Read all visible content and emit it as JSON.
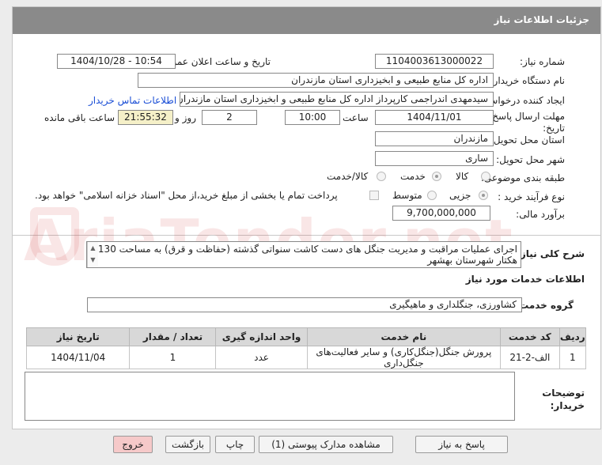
{
  "header": {
    "title": "جزئیات اطلاعات نیاز"
  },
  "form": {
    "need_number_label": "شماره نیاز:",
    "need_number": "1104003613000022",
    "announce_label": "تاریخ و ساعت اعلان عمومی:",
    "announce_value": "1404/10/28 - 10:54",
    "buyer_label": "نام دستگاه خریدار:",
    "buyer_value": "اداره کل منابع طبیعی و ابخیزداری استان مازندران",
    "creator_label": "ایجاد کننده درخواست:",
    "creator_value": "سیدمهدی اندراجمی کارپرداز اداره کل منابع طبیعی و ابخیزداری استان مازندران",
    "contact_link": "اطلاعات تماس خریدار",
    "deadline_label_1": "مهلت ارسال پاسخ: تا",
    "deadline_label_2": "تاریخ:",
    "deadline_date": "1404/11/01",
    "time_label": "ساعت",
    "deadline_time": "10:00",
    "days_value": "2",
    "days_label": "روز و",
    "remaining_time": "21:55:32",
    "remaining_label": "ساعت باقی مانده",
    "province_label": "استان محل تحویل:",
    "province_value": "مازندران",
    "city_label": "شهر محل تحویل:",
    "city_value": "ساری",
    "category_label": "طبقه بندی موضوعی:",
    "category_options": [
      "کالا",
      "خدمت",
      "کالا/خدمت"
    ],
    "category_selected": "خدمت",
    "process_label": "نوع فرآیند خرید :",
    "process_options": [
      "جزیی",
      "متوسط"
    ],
    "process_selected": "جزیی",
    "payment_note": "پرداخت تمام یا بخشی از مبلغ خرید،از محل \"اسناد خزانه اسلامی\" خواهد بود.",
    "estimate_label": "برآورد مالی:",
    "estimate_value": "9,700,000,000"
  },
  "summary": {
    "label": "شرح کلی نیاز:",
    "text": "اجرای عملیات مراقبت و مدیریت جنگل های دست کاشت سنواتی گذشته (حفاظت و قرق) به مساحت 130 هکتار شهرستان بهشهر"
  },
  "services": {
    "section_title": "اطلاعات خدمات مورد نیاز",
    "group_label": "گروه خدمت:",
    "group_value": "کشاورزی، جنگلداری و ماهیگیری",
    "columns": [
      "ردیف",
      "کد خدمت",
      "نام خدمت",
      "واحد اندازه گیری",
      "تعداد / مقدار",
      "تاریخ نیاز"
    ],
    "rows": [
      [
        "1",
        "الف-2-21",
        "پرورش جنگل(جنگل‌کاری) و سایر فعالیت‌های جنگل‌داری",
        "عدد",
        "1",
        "1404/11/04"
      ]
    ]
  },
  "notes": {
    "label_1": "توضیحات",
    "label_2": "خریدار:"
  },
  "buttons": {
    "reply": "پاسخ به نیاز",
    "attachments": "مشاهده مدارک پیوستی (1)",
    "print": "چاپ",
    "back": "بازگشت",
    "exit": "خروج"
  },
  "colors": {
    "header_bg": "#8a8a8a",
    "link": "#1a4ed6",
    "exit_bg": "#f6c9c9",
    "remaining_bg": "#f5f0c8"
  }
}
